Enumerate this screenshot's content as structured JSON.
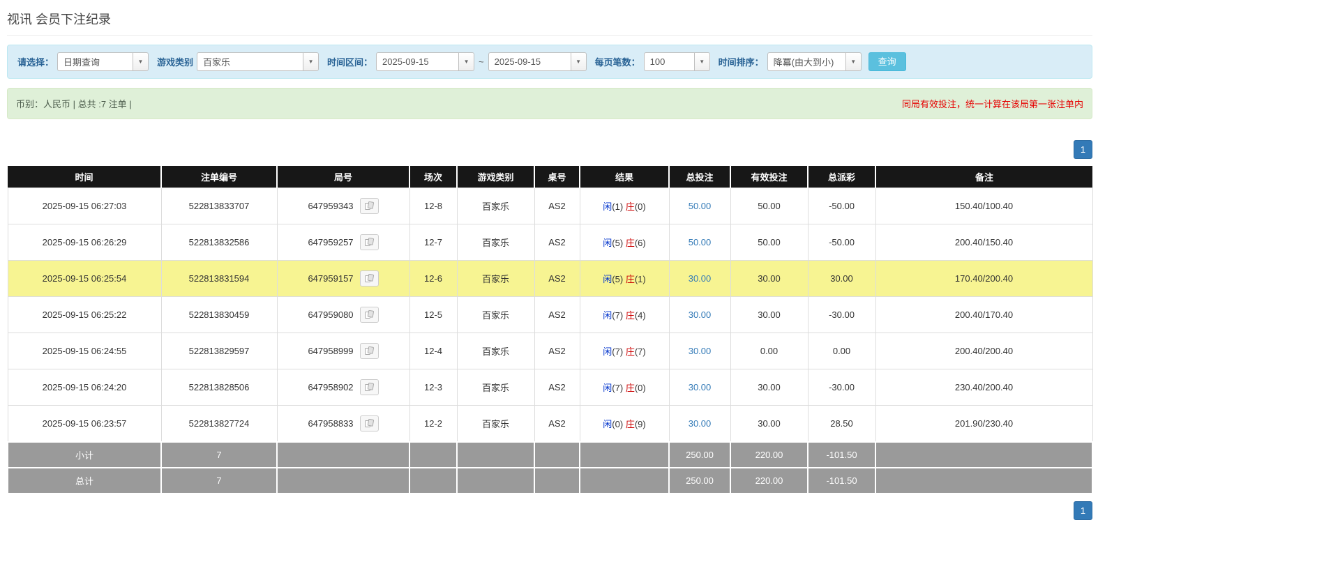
{
  "page": {
    "title": "视讯 会员下注纪录"
  },
  "filters": {
    "select_label": "请选择：",
    "select_value": "日期查询",
    "game_type_label": "游戏类别",
    "game_type_value": "百家乐",
    "date_range_label": "时间区间：",
    "date_from": "2025-09-15",
    "date_tilde": "~",
    "date_to": "2025-09-15",
    "page_size_label": "每页笔数：",
    "page_size_value": "100",
    "sort_label": "时间排序：",
    "sort_value": "降冪(由大到小)",
    "search_button": "查询"
  },
  "summary": {
    "left": "币别：人民币 | 总共 :7 注单 |",
    "right": "同局有效投注，统一计算在该局第一张注单内"
  },
  "pagination": {
    "page": "1"
  },
  "table": {
    "headers": [
      "时间",
      "注单编号",
      "局号",
      "场次",
      "游戏类别",
      "桌号",
      "结果",
      "总投注",
      "有效投注",
      "总派彩",
      "备注"
    ],
    "rows": [
      {
        "time": "2025-09-15 06:27:03",
        "bet_id": "522813833707",
        "round_id": "647959343",
        "session": "12-8",
        "game": "百家乐",
        "table_no": "AS2",
        "p_label": "闲",
        "p_val": "(1)",
        "b_label": "庄",
        "b_val": "(0)",
        "total_bet": "50.00",
        "valid_bet": "50.00",
        "payout": "-50.00",
        "note": "150.40/100.40",
        "highlight": false
      },
      {
        "time": "2025-09-15 06:26:29",
        "bet_id": "522813832586",
        "round_id": "647959257",
        "session": "12-7",
        "game": "百家乐",
        "table_no": "AS2",
        "p_label": "闲",
        "p_val": "(5)",
        "b_label": "庄",
        "b_val": "(6)",
        "total_bet": "50.00",
        "valid_bet": "50.00",
        "payout": "-50.00",
        "note": "200.40/150.40",
        "highlight": false
      },
      {
        "time": "2025-09-15 06:25:54",
        "bet_id": "522813831594",
        "round_id": "647959157",
        "session": "12-6",
        "game": "百家乐",
        "table_no": "AS2",
        "p_label": "闲",
        "p_val": "(5)",
        "b_label": "庄",
        "b_val": "(1)",
        "total_bet": "30.00",
        "valid_bet": "30.00",
        "payout": "30.00",
        "note": "170.40/200.40",
        "highlight": true
      },
      {
        "time": "2025-09-15 06:25:22",
        "bet_id": "522813830459",
        "round_id": "647959080",
        "session": "12-5",
        "game": "百家乐",
        "table_no": "AS2",
        "p_label": "闲",
        "p_val": "(7)",
        "b_label": "庄",
        "b_val": "(4)",
        "total_bet": "30.00",
        "valid_bet": "30.00",
        "payout": "-30.00",
        "note": "200.40/170.40",
        "highlight": false
      },
      {
        "time": "2025-09-15 06:24:55",
        "bet_id": "522813829597",
        "round_id": "647958999",
        "session": "12-4",
        "game": "百家乐",
        "table_no": "AS2",
        "p_label": "闲",
        "p_val": "(7)",
        "b_label": "庄",
        "b_val": "(7)",
        "total_bet": "30.00",
        "valid_bet": "0.00",
        "payout": "0.00",
        "note": "200.40/200.40",
        "highlight": false
      },
      {
        "time": "2025-09-15 06:24:20",
        "bet_id": "522813828506",
        "round_id": "647958902",
        "session": "12-3",
        "game": "百家乐",
        "table_no": "AS2",
        "p_label": "闲",
        "p_val": "(7)",
        "b_label": "庄",
        "b_val": "(0)",
        "total_bet": "30.00",
        "valid_bet": "30.00",
        "payout": "-30.00",
        "note": "230.40/200.40",
        "highlight": false
      },
      {
        "time": "2025-09-15 06:23:57",
        "bet_id": "522813827724",
        "round_id": "647958833",
        "session": "12-2",
        "game": "百家乐",
        "table_no": "AS2",
        "p_label": "闲",
        "p_val": "(0)",
        "b_label": "庄",
        "b_val": "(9)",
        "total_bet": "30.00",
        "valid_bet": "30.00",
        "payout": "28.50",
        "note": "201.90/230.40",
        "highlight": false
      }
    ],
    "subtotal": {
      "label": "小计",
      "count": "7",
      "total_bet": "250.00",
      "valid_bet": "220.00",
      "payout": "-101.50"
    },
    "total": {
      "label": "总计",
      "count": "7",
      "total_bet": "250.00",
      "valid_bet": "220.00",
      "payout": "-101.50"
    }
  }
}
